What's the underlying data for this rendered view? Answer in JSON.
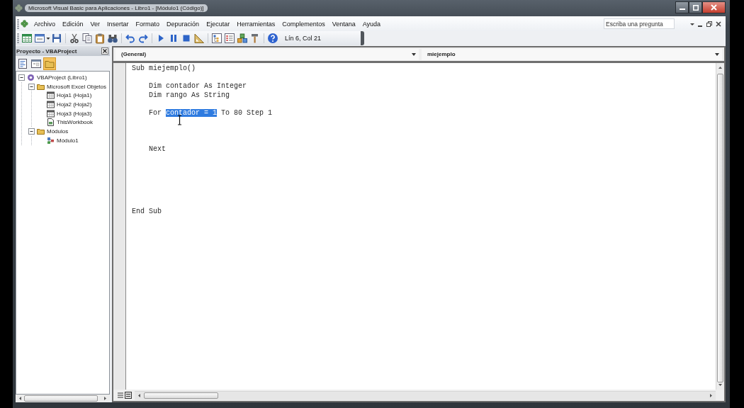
{
  "window": {
    "title": "Microsoft Visual Basic para Aplicaciones - Libro1 - [Módulo1 (Código)]"
  },
  "menu_bar": {
    "items": [
      "Archivo",
      "Edición",
      "Ver",
      "Insertar",
      "Formato",
      "Depuración",
      "Ejecutar",
      "Herramientas",
      "Complementos",
      "Ventana",
      "Ayuda"
    ],
    "help_search": {
      "placeholder": "Escriba una pregunta"
    }
  },
  "toolbar": {
    "buttons": [
      {
        "kind": "excel"
      },
      {
        "kind": "userform"
      },
      {
        "kind": "caret"
      },
      {
        "kind": "save"
      },
      {
        "kind": "separator"
      },
      {
        "kind": "cut"
      },
      {
        "kind": "copy"
      },
      {
        "kind": "paste"
      },
      {
        "kind": "find"
      },
      {
        "kind": "separator"
      },
      {
        "kind": "undo"
      },
      {
        "kind": "redo"
      },
      {
        "kind": "separator"
      },
      {
        "kind": "run"
      },
      {
        "kind": "pause"
      },
      {
        "kind": "stop"
      },
      {
        "kind": "design"
      },
      {
        "kind": "separator"
      },
      {
        "kind": "project"
      },
      {
        "kind": "properties"
      },
      {
        "kind": "browser"
      },
      {
        "kind": "toolbox"
      },
      {
        "kind": "separator"
      },
      {
        "kind": "help"
      }
    ],
    "cursor_position": "Lín 6, Col 21"
  },
  "project_explorer": {
    "title": "Proyecto - VBAProject",
    "buttons": [
      {
        "kind": "view_code",
        "on": false
      },
      {
        "kind": "view_object",
        "on": false
      },
      {
        "kind": "toggle_folders",
        "on": true
      }
    ],
    "tree": [
      {
        "label": "VBAProject (Libro1)",
        "kind": "project",
        "expanded": true,
        "children": [
          {
            "label": "Microsoft Excel Objetos",
            "kind": "folder",
            "expanded": true,
            "children": [
              {
                "label": "Hoja1 (Hoja1)",
                "kind": "sheet"
              },
              {
                "label": "Hoja2 (Hoja2)",
                "kind": "sheet"
              },
              {
                "label": "Hoja3 (Hoja3)",
                "kind": "sheet"
              },
              {
                "label": "ThisWorkbook",
                "kind": "workbook"
              }
            ]
          },
          {
            "label": "Módulos",
            "kind": "folder",
            "expanded": true,
            "children": [
              {
                "label": "Módulo1",
                "kind": "module"
              }
            ]
          }
        ]
      }
    ]
  },
  "code_window": {
    "object_dropdown": "(General)",
    "procedure_dropdown": "miejemplo",
    "lines": [
      {
        "kind": "code",
        "segments": [
          {
            "text": "Sub miejemplo()",
            "selected": false
          }
        ]
      },
      {
        "kind": "blank"
      },
      {
        "kind": "code",
        "segments": [
          {
            "text": "    Dim contador As Integer",
            "selected": false
          }
        ]
      },
      {
        "kind": "code",
        "segments": [
          {
            "text": "    Dim rango As String",
            "selected": false
          }
        ]
      },
      {
        "kind": "blank"
      },
      {
        "kind": "code",
        "segments": [
          {
            "text": "    For ",
            "selected": false
          },
          {
            "text": "contador = 1",
            "selected": true
          },
          {
            "text": " To 80 Step 1",
            "selected": false
          }
        ]
      },
      {
        "kind": "blank"
      },
      {
        "kind": "blank"
      },
      {
        "kind": "blank"
      },
      {
        "kind": "code",
        "segments": [
          {
            "text": "    Next",
            "selected": false
          }
        ]
      },
      {
        "kind": "blank"
      },
      {
        "kind": "blank"
      },
      {
        "kind": "blank"
      },
      {
        "kind": "blank"
      },
      {
        "kind": "blank"
      },
      {
        "kind": "blank"
      },
      {
        "kind": "code",
        "segments": [
          {
            "text": "End Sub",
            "selected": false
          }
        ]
      }
    ]
  }
}
